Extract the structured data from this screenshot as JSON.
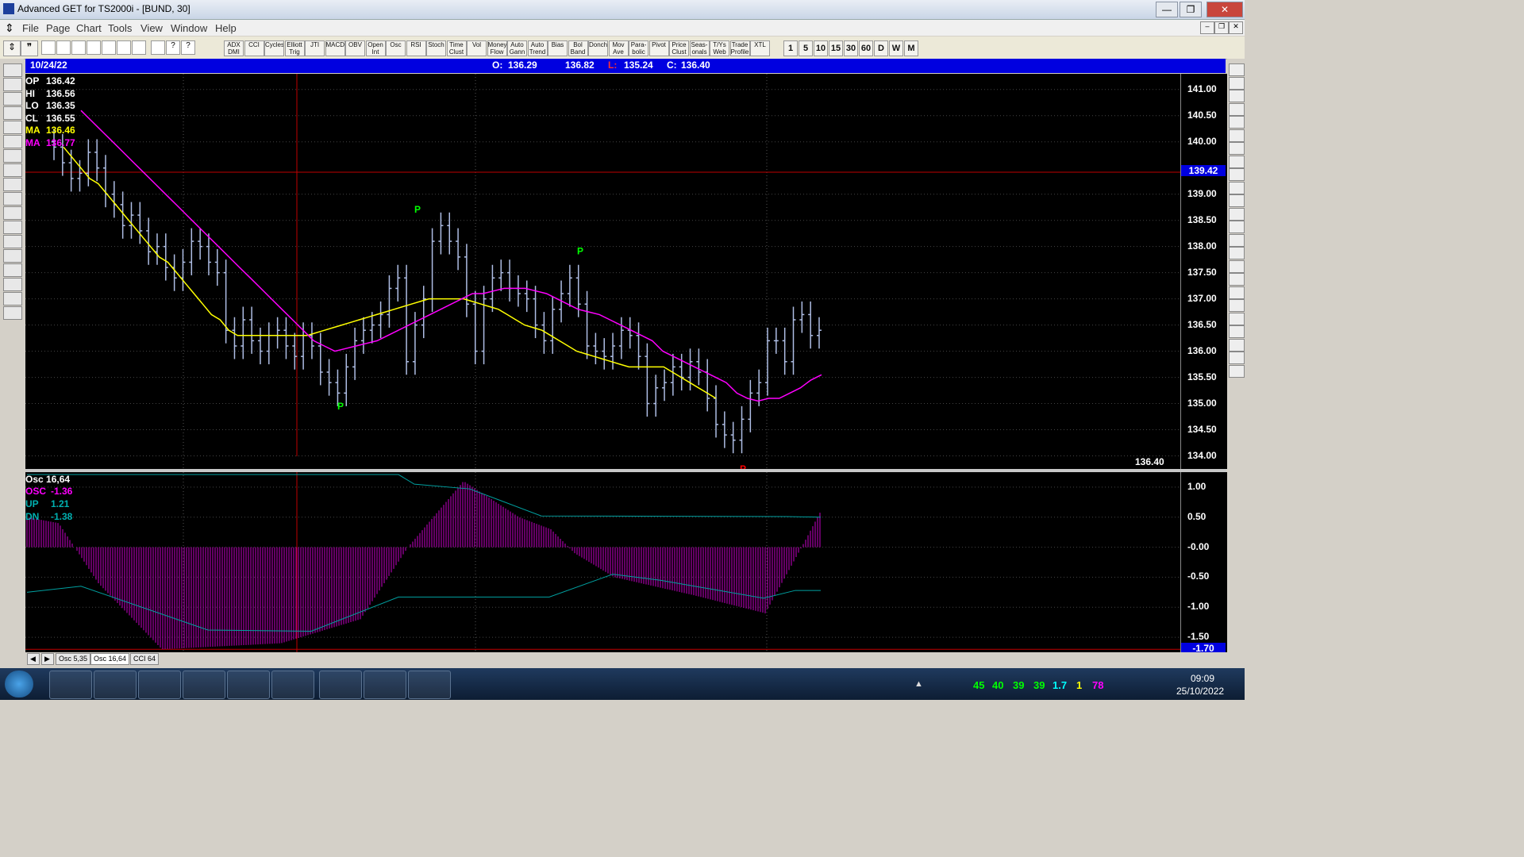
{
  "window": {
    "title": "Advanced GET for TS2000i - [BUND, 30]",
    "minimize": "—",
    "maximize": "❐",
    "close": "✕"
  },
  "menu": [
    "File",
    "Page",
    "Chart",
    "Tools",
    "View",
    "Window",
    "Help"
  ],
  "toolbar": {
    "indicators": [
      "ADX DMI",
      "CCI",
      "Cycles",
      "Elliott Trig",
      "JTI",
      "MACD",
      "OBV",
      "Open Int",
      "Osc",
      "RSI",
      "Stoch",
      "Time Clust",
      "Vol",
      "Money Flow",
      "Auto Gann",
      "Auto Trend",
      "Bias",
      "Bol Band",
      "Donch",
      "Mov Ave",
      "Para-bolic",
      "Pivot",
      "Price Clust",
      "Seas-onals",
      "T/Ys Web",
      "Trade Profile",
      "XTL"
    ],
    "timeframes": [
      "1",
      "5",
      "10",
      "15",
      "30",
      "60",
      "D",
      "W",
      "M"
    ]
  },
  "header": {
    "date": "10/24/22",
    "o_label": "O:",
    "o": "136.29",
    "h": "136.82",
    "l_label": "L:",
    "l": "135.24",
    "c_label": "C:",
    "c": "136.40"
  },
  "info": [
    {
      "k": "OP",
      "v": "136.42",
      "color": "#ffffff"
    },
    {
      "k": "HI",
      "v": "136.56",
      "color": "#ffffff"
    },
    {
      "k": "LO",
      "v": "136.35",
      "color": "#ffffff"
    },
    {
      "k": "CL",
      "v": "136.55",
      "color": "#ffffff"
    },
    {
      "k": "MA",
      "v": "136.46",
      "color": "#ffff00"
    },
    {
      "k": "MA",
      "v": "136.77",
      "color": "#ff00ff"
    }
  ],
  "price_axis": {
    "ticks": [
      "141.00",
      "140.50",
      "140.00",
      "139.00",
      "138.50",
      "138.00",
      "137.50",
      "137.00",
      "136.50",
      "136.00",
      "135.50",
      "135.00",
      "134.50",
      "134.00"
    ],
    "marker": "139.42",
    "last": "136.40"
  },
  "osc": {
    "title": "Osc 16,64",
    "lines": [
      {
        "k": "OSC",
        "v": "-1.36",
        "color": "#ff00ff"
      },
      {
        "k": "UP",
        "v": "1.21",
        "color": "#00b0b0"
      },
      {
        "k": "DN",
        "v": "-1.38",
        "color": "#00b0b0"
      }
    ],
    "ticks": [
      "1.00",
      "0.50",
      "-0.00",
      "-0.50",
      "-1.00",
      "-1.50"
    ],
    "marker": "-1.70"
  },
  "pivots": [
    {
      "label": "P",
      "color": "#00ff00"
    },
    {
      "label": "P",
      "color": "#00ff00"
    },
    {
      "label": "P",
      "color": "#00ff00"
    },
    {
      "label": "P",
      "color": "#ff0000"
    }
  ],
  "tabs": [
    "Osc 5,35",
    "Osc 16,64",
    "CCI 64"
  ],
  "taskbar": {
    "time": "09:09",
    "date": "25/10/2022",
    "tray": [
      "45",
      "40",
      "39",
      "39",
      "1.7",
      "1",
      "78"
    ]
  },
  "colors": {
    "bars": "#aebde4",
    "ma_fast": "#ffff00",
    "ma_slow": "#ff00ff",
    "osc_hist": "#c800c8",
    "band": "#00a0a0",
    "marker": "#0000e0"
  },
  "chart_data": {
    "type": "line",
    "title": "BUND, 30",
    "xlabel": "",
    "ylabel": "",
    "ylim": [
      133.75,
      141.3
    ],
    "close": [
      139.9,
      139.6,
      139.3,
      139.4,
      139.8,
      139.5,
      139.0,
      138.8,
      138.4,
      138.6,
      138.3,
      137.9,
      138.0,
      137.6,
      137.4,
      137.7,
      138.1,
      138.0,
      137.7,
      137.5,
      136.4,
      136.1,
      136.6,
      136.2,
      136.0,
      136.3,
      136.4,
      136.1,
      135.9,
      136.3,
      136.1,
      135.6,
      135.4,
      135.2,
      135.7,
      136.2,
      136.4,
      136.5,
      136.7,
      137.2,
      137.4,
      135.8,
      136.5,
      137.0,
      138.1,
      138.4,
      138.1,
      137.8,
      136.9,
      136.0,
      137.0,
      137.4,
      137.5,
      137.2,
      137.1,
      137.0,
      136.5,
      136.2,
      136.8,
      137.1,
      137.4,
      136.9,
      136.1,
      136.0,
      135.9,
      136.1,
      136.4,
      136.3,
      135.9,
      135.0,
      135.3,
      135.4,
      135.7,
      135.5,
      135.8,
      135.6,
      135.1,
      134.6,
      134.4,
      134.3,
      134.7,
      135.2,
      135.4,
      136.2,
      136.2,
      135.8,
      136.6,
      136.7,
      136.3,
      136.4
    ],
    "series": [
      {
        "name": "MA",
        "values": [
          139.9,
          139.7,
          139.5,
          139.3,
          139.2,
          139.0,
          138.8,
          138.6,
          138.4,
          138.2,
          138.0,
          137.8,
          137.7,
          137.5,
          137.3,
          137.1,
          136.9,
          136.7,
          136.6,
          136.4,
          136.3,
          136.3,
          136.3,
          136.3,
          136.3,
          136.3,
          136.3,
          136.3,
          136.3,
          136.35,
          136.4,
          136.45,
          136.5,
          136.55,
          136.6,
          136.65,
          136.7,
          136.75,
          136.8,
          136.85,
          136.9,
          136.95,
          137.0,
          137.0,
          137.0,
          137.0,
          137.0,
          136.95,
          136.9,
          136.85,
          136.8,
          136.7,
          136.6,
          136.5,
          136.45,
          136.4,
          136.3,
          136.2,
          136.1,
          136.0,
          135.95,
          135.9,
          135.85,
          135.8,
          135.75,
          135.7,
          135.7,
          135.7,
          135.7,
          135.7,
          135.6,
          135.5,
          135.4,
          135.3,
          135.2,
          135.1
        ]
      },
      {
        "name": "MA",
        "values": [
          140.6,
          140.4,
          140.2,
          140.0,
          139.8,
          139.6,
          139.4,
          139.2,
          139.0,
          138.8,
          138.6,
          138.4,
          138.2,
          138.0,
          137.8,
          137.6,
          137.4,
          137.2,
          137.0,
          136.8,
          136.6,
          136.4,
          136.2,
          136.1,
          136.0,
          136.05,
          136.1,
          136.15,
          136.2,
          136.3,
          136.4,
          136.5,
          136.6,
          136.7,
          136.8,
          136.9,
          137.0,
          137.1,
          137.1,
          137.15,
          137.2,
          137.2,
          137.2,
          137.15,
          137.1,
          137.0,
          136.9,
          136.8,
          136.75,
          136.7,
          136.6,
          136.5,
          136.4,
          136.3,
          136.2,
          136.0,
          135.9,
          135.8,
          135.7,
          135.6,
          135.5,
          135.4,
          135.2,
          135.1,
          135.05,
          135.1,
          135.1,
          135.2,
          135.3,
          135.45,
          135.55
        ]
      }
    ]
  }
}
